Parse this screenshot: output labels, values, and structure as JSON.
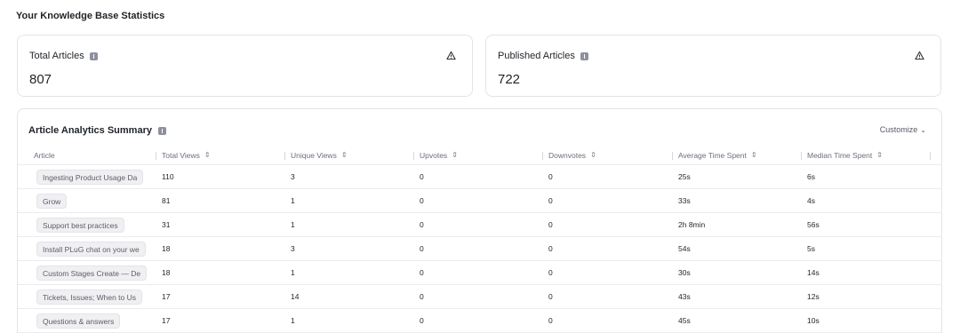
{
  "page": {
    "title": "Your Knowledge Base Statistics"
  },
  "cards": [
    {
      "label": "Total Articles",
      "value": "807"
    },
    {
      "label": "Published Articles",
      "value": "722"
    }
  ],
  "summary": {
    "title": "Article Analytics Summary",
    "customize_label": "Customize",
    "columns": [
      "Article",
      "Total Views",
      "Unique Views",
      "Upvotes",
      "Downvotes",
      "Average Time Spent",
      "Median Time Spent"
    ],
    "rows": [
      [
        "Ingesting Product Usage Da",
        "110",
        "3",
        "0",
        "0",
        "25s",
        "6s"
      ],
      [
        "Grow",
        "81",
        "1",
        "0",
        "0",
        "33s",
        "4s"
      ],
      [
        "Support best practices",
        "31",
        "1",
        "0",
        "0",
        "2h 8min",
        "56s"
      ],
      [
        "Install PLuG chat on your we",
        "18",
        "3",
        "0",
        "0",
        "54s",
        "5s"
      ],
      [
        "Custom Stages Create — De",
        "18",
        "1",
        "0",
        "0",
        "30s",
        "14s"
      ],
      [
        "Tickets, Issues; When to Us",
        "17",
        "14",
        "0",
        "0",
        "43s",
        "12s"
      ],
      [
        "Questions & answers",
        "17",
        "1",
        "0",
        "0",
        "45s",
        "10s"
      ]
    ]
  }
}
